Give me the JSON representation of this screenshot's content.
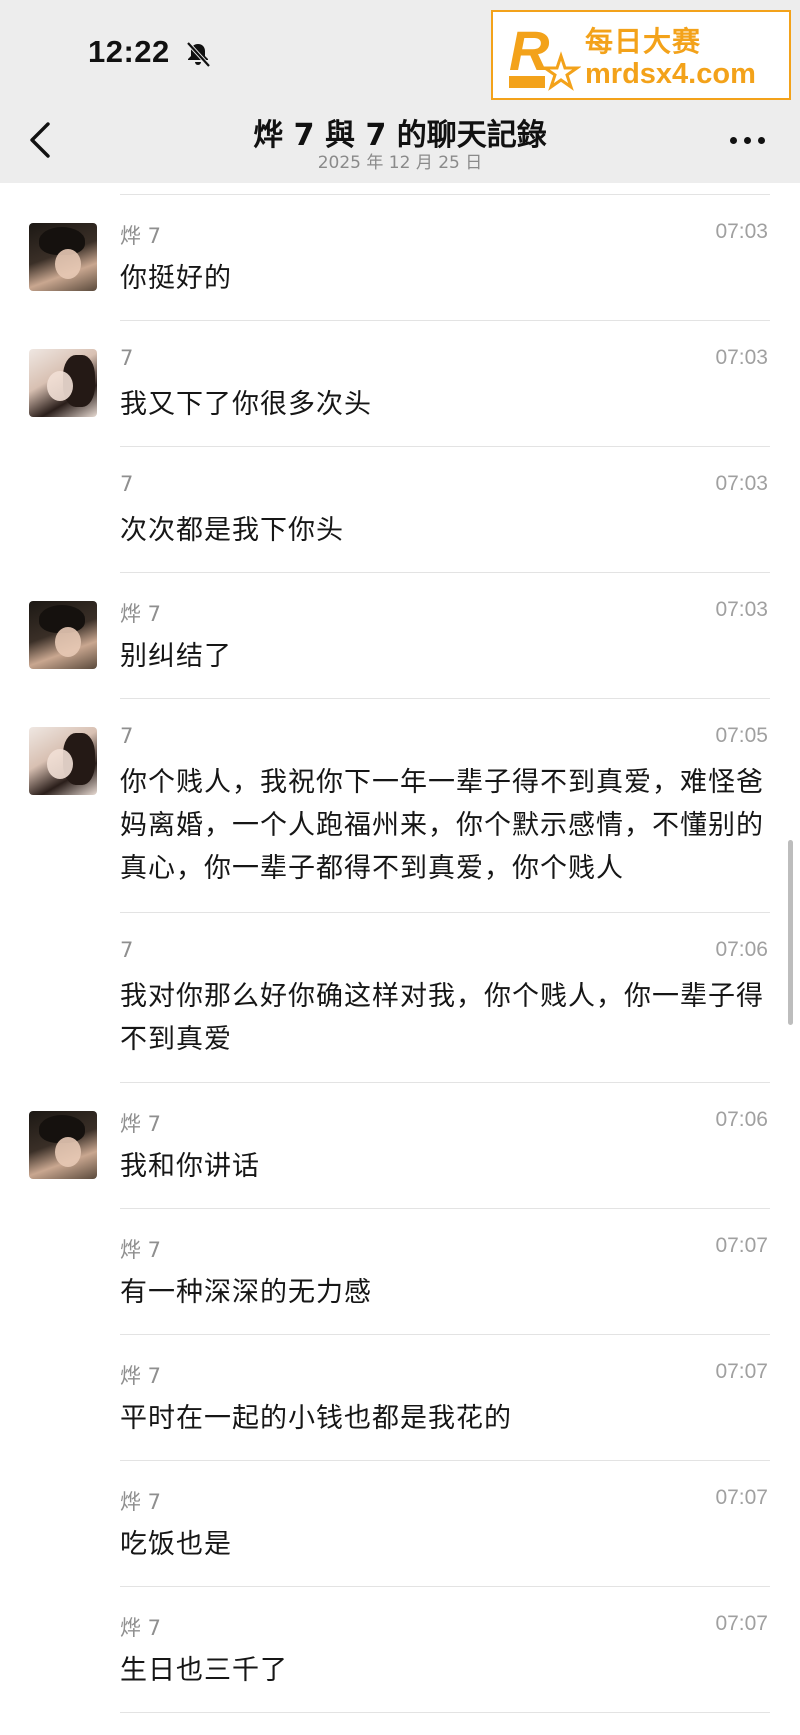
{
  "status_bar": {
    "time": "12:22"
  },
  "watermark": {
    "text_cn": "每日大赛",
    "url": "mrdsx4.com",
    "accent_color": "#f3a21a"
  },
  "nav": {
    "title": "烨 7 與 7 的聊天記錄",
    "subtitle": "2025 年 12 月 25 日"
  },
  "messages": [
    {
      "sender": "烨 7",
      "time": "07:03",
      "text": "你挺好的",
      "avatar": "avatar-1"
    },
    {
      "sender": "7",
      "time": "07:03",
      "text": "我又下了你很多次头",
      "avatar": "avatar-2"
    },
    {
      "sender": "7",
      "time": "07:03",
      "text": "次次都是我下你头",
      "avatar": ""
    },
    {
      "sender": "烨 7",
      "time": "07:03",
      "text": "别纠结了",
      "avatar": "avatar-1"
    },
    {
      "sender": "7",
      "time": "07:05",
      "text": "你个贱人，我祝你下一年一辈子得不到真爱，难怪爸妈离婚，一个人跑福州来，你个默示感情，不懂别的真心，你一辈子都得不到真爱，你个贱人",
      "avatar": "avatar-2"
    },
    {
      "sender": "7",
      "time": "07:06",
      "text": "我对你那么好你确这样对我，你个贱人，你一辈子得不到真爱",
      "avatar": ""
    },
    {
      "sender": "烨 7",
      "time": "07:06",
      "text": "我和你讲话",
      "avatar": "avatar-1"
    },
    {
      "sender": "烨 7",
      "time": "07:07",
      "text": "有一种深深的无力感",
      "avatar": ""
    },
    {
      "sender": "烨 7",
      "time": "07:07",
      "text": "平时在一起的小钱也都是我花的",
      "avatar": ""
    },
    {
      "sender": "烨 7",
      "time": "07:07",
      "text": "吃饭也是",
      "avatar": ""
    },
    {
      "sender": "烨 7",
      "time": "07:07",
      "text": "生日也三千了",
      "avatar": ""
    }
  ]
}
